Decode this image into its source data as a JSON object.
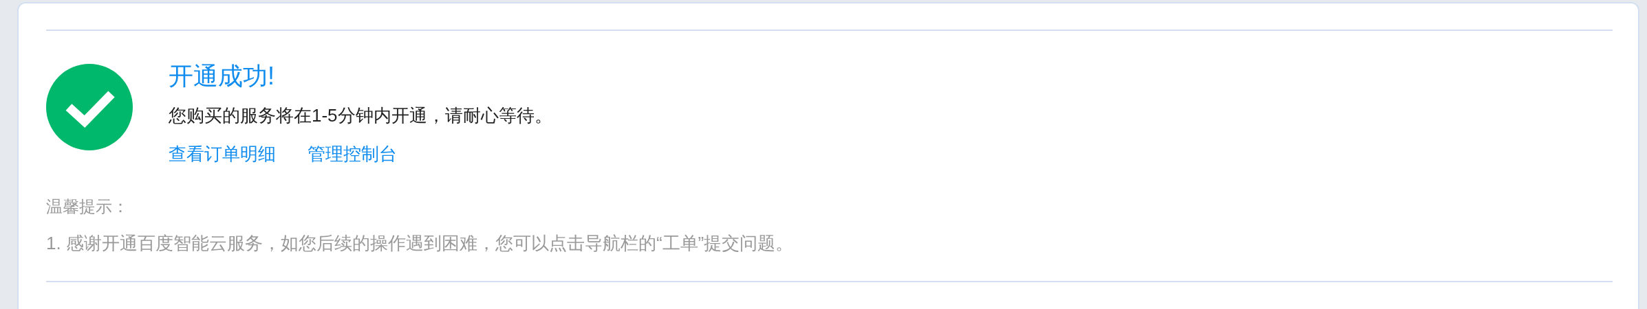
{
  "result": {
    "title": "开通成功!",
    "message": "您购买的服务将在1-5分钟内开通，请耐心等待。",
    "links": [
      "查看订单明细",
      "管理控制台"
    ]
  },
  "tips": {
    "heading": "温馨提示：",
    "items": [
      "1. 感谢开通百度智能云服务，如您后续的操作遇到困难，您可以点击导航栏的“工单”提交问题。"
    ]
  }
}
